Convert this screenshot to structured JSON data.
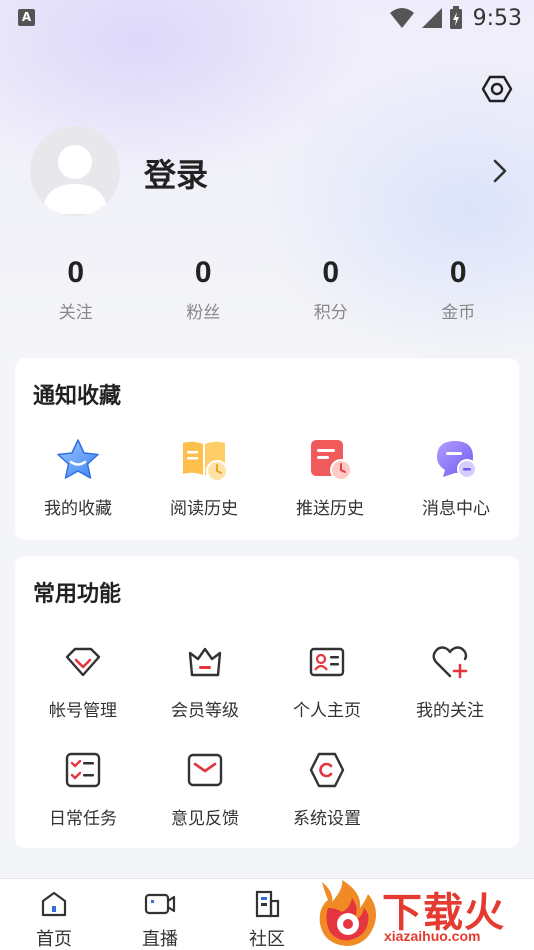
{
  "status_bar": {
    "left_badge": "A",
    "time": "9:53"
  },
  "header": {
    "login_label": "登录"
  },
  "stats": [
    {
      "value": "0",
      "label": "关注"
    },
    {
      "value": "0",
      "label": "粉丝"
    },
    {
      "value": "0",
      "label": "积分"
    },
    {
      "value": "0",
      "label": "金币"
    }
  ],
  "notifications": {
    "title": "通知收藏",
    "items": [
      {
        "label": "我的收藏",
        "icon": "star-icon"
      },
      {
        "label": "阅读历史",
        "icon": "book-clock-icon"
      },
      {
        "label": "推送历史",
        "icon": "push-clock-icon"
      },
      {
        "label": "消息中心",
        "icon": "chat-bubble-icon"
      }
    ]
  },
  "functions": {
    "title": "常用功能",
    "items": [
      {
        "label": "帐号管理",
        "icon": "account-diamond-icon"
      },
      {
        "label": "会员等级",
        "icon": "crown-icon"
      },
      {
        "label": "个人主页",
        "icon": "id-card-icon"
      },
      {
        "label": "我的关注",
        "icon": "heart-plus-icon"
      },
      {
        "label": "日常任务",
        "icon": "checklist-icon"
      },
      {
        "label": "意见反馈",
        "icon": "envelope-icon"
      },
      {
        "label": "系统设置",
        "icon": "hex-settings-icon"
      }
    ]
  },
  "bottom_nav": [
    {
      "label": "首页",
      "icon": "home-icon"
    },
    {
      "label": "直播",
      "icon": "video-icon"
    },
    {
      "label": "社区",
      "icon": "building-icon"
    }
  ],
  "watermark": {
    "text": "下载火",
    "sub": "xiazaihuo.com"
  },
  "colors": {
    "accent_red": "#e5353f",
    "background": "#f4f5f8"
  }
}
